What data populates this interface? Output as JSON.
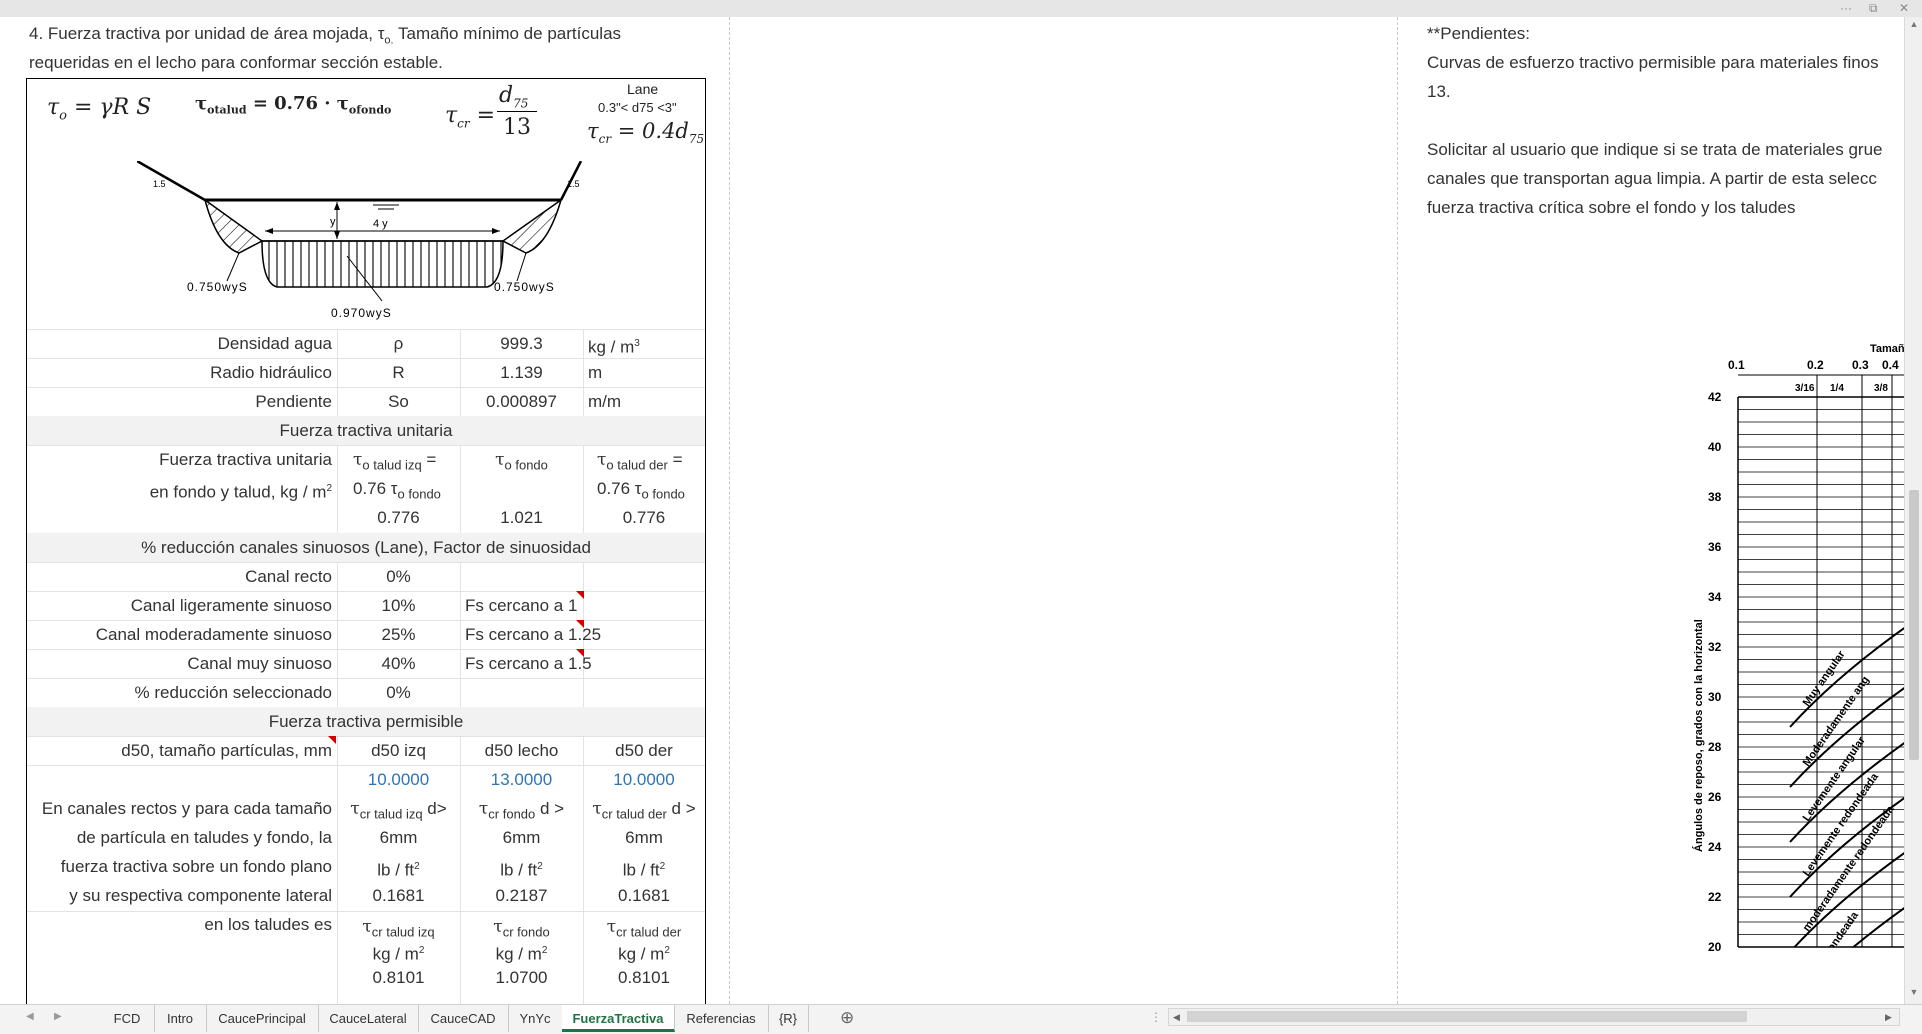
{
  "intro": {
    "line1": "4. Fuerza tractiva por unidad de área mojada, τ",
    "line1_sub": "o.",
    "line1_rest": "  Tamaño mínimo de partículas",
    "line2": "requeridas en el lecho para conformar sección estable."
  },
  "formulas": {
    "f1": "τ",
    "f1_sub": "o",
    "f1_rest": " = γR S",
    "f2_a": "τ",
    "f2_a_sub": "otalud",
    "f2_mid": " = 0.76 · τ",
    "f2_b_sub": "ofondo",
    "f3_a": "τ",
    "f3_a_sub": "cr",
    "f3_eq": " =",
    "f3_num": "d",
    "f3_num_sub": "75",
    "f3_den": "13",
    "lane_title": "Lane",
    "lane_range": "0.3\"< d75 <3\"",
    "f4_a": "τ",
    "f4_a_sub": "cr",
    "f4_rest": " = 0.4d",
    "f4_sub2": "75"
  },
  "diagram": {
    "slope_left": "1.5",
    "slope_left_top": "1",
    "slope_right": "1.5",
    "slope_right_top": "1",
    "depth": "y",
    "width": "4 y",
    "label_left": "0.750wyS",
    "label_right": "0.750wyS",
    "label_bottom": "0.970wyS"
  },
  "props": [
    {
      "label": "Densidad agua",
      "symbol": "ρ",
      "value": "999.3",
      "unit": "kg / m",
      "unit_sup": "3"
    },
    {
      "label": "Radio hidráulico",
      "symbol": "R",
      "value": "1.139",
      "unit": "m",
      "unit_sup": ""
    },
    {
      "label": "Pendiente",
      "symbol": "So",
      "value": "0.000897",
      "unit": "m/m",
      "unit_sup": ""
    }
  ],
  "fuerza_unitaria": {
    "header": "Fuerza tractiva unitaria",
    "label1": "Fuerza tractiva unitaria",
    "label2": "en fondo y talud, kg / m",
    "label2_sup": "2",
    "c1_line1": "τ",
    "c1_line1_sub": "o talud izq",
    "c1_line1_rest": " =",
    "c1_line2": "0.76 τ",
    "c1_line2_sub": "o fondo",
    "c2_line1": "τ",
    "c2_line1_sub": "o fondo",
    "c3_line1": "τ",
    "c3_line1_sub": "o talud der",
    "c3_line1_rest": " =",
    "c3_line2": "0.76 τ",
    "c3_line2_sub": "o fondo",
    "values": [
      "0.776",
      "1.021",
      "0.776"
    ]
  },
  "reduccion": {
    "header": "% reducción canales sinuosos (Lane), Factor de sinuosidad",
    "rows": [
      {
        "label": "Canal recto",
        "pct": "0%",
        "note": ""
      },
      {
        "label": "Canal ligeramente sinuoso",
        "pct": "10%",
        "note": "Fs cercano a 1"
      },
      {
        "label": "Canal moderadamente sinuoso",
        "pct": "25%",
        "note": "Fs cercano a 1.25"
      },
      {
        "label": "Canal muy sinuoso",
        "pct": "40%",
        "note": "Fs cercano a 1.5"
      },
      {
        "label": "% reducción seleccionado",
        "pct": "0%",
        "note": ""
      }
    ]
  },
  "permisible": {
    "header": "Fuerza tractiva permisible",
    "d50_label": "d50, tamaño partículas, mm",
    "d50_heads": [
      "d50 izq",
      "d50 lecho",
      "d50 der"
    ],
    "d50_values": [
      "10.0000",
      "13.0000",
      "10.0000"
    ],
    "desc": [
      "En canales rectos y para cada tamaño",
      "de partícula en taludes y fondo, la",
      "fuerza tractiva sobre un fondo plano",
      "y su respectiva componente lateral",
      "en los taludes es"
    ],
    "cols": [
      {
        "h": "τ",
        "h_sub": "cr talud izq",
        "h_rest": " d>",
        "h2": "6mm",
        "unit1": "lb / ft",
        "val1": "0.1681",
        "h3": "τ",
        "h3_sub": "cr talud izq",
        "unit2": "kg / m",
        "val2": "0.8101"
      },
      {
        "h": "τ",
        "h_sub": "cr fondo",
        "h_rest": " d >",
        "h2": "6mm",
        "unit1": "lb / ft",
        "val1": "0.2187",
        "h3": "τ",
        "h3_sub": "cr fondo",
        "unit2": "kg / m",
        "val2": "1.0700"
      },
      {
        "h": "τ",
        "h_sub": "cr talud der",
        "h_rest": " d >",
        "h2": "6mm",
        "unit1": "lb / ft",
        "val1": "0.1681",
        "h3": "τ",
        "h3_sub": "cr talud der",
        "unit2": "kg / m",
        "val2": "0.8101"
      }
    ],
    "sup": "2"
  },
  "right_notes": {
    "title": "**Pendientes:",
    "line1": "Curvas de esfuerzo tractivo permisible para materiales finos",
    "line2": "13.",
    "line3": "Solicitar al usuario que indique si se trata de materiales grue",
    "line4": "canales que transportan agua limpia. A partir de esta selecc",
    "line5": "fuerza tractiva crítica sobre el fondo y los taludes"
  },
  "graph": {
    "top_label": "Tamaño d",
    "top_ticks": [
      "0.1",
      "0.2",
      "0.3",
      "0.4"
    ],
    "fraction_ticks": [
      "3/16",
      "1/4",
      "3/8"
    ],
    "y_ticks": [
      "42",
      "40",
      "38",
      "36",
      "34",
      "32",
      "30",
      "28",
      "26",
      "24",
      "22",
      "20"
    ],
    "y_axis_label": "Ángulos de reposo, grados con la horizontal",
    "curves": [
      "Muy angular",
      "Moderadamente ang",
      "Levemente angular",
      "Levemente redondeada",
      "moderadamente redondeada",
      "muy redondeada"
    ]
  },
  "tabs": [
    "FCD",
    "Intro",
    "CaucePrincipal",
    "CauceLateral",
    "CauceCAD",
    "YnYc",
    "FuerzaTractiva",
    "Referencias",
    "{R}"
  ],
  "active_tab": "FuerzaTractiva",
  "window_controls": [
    "···",
    "⧉",
    "✕"
  ]
}
